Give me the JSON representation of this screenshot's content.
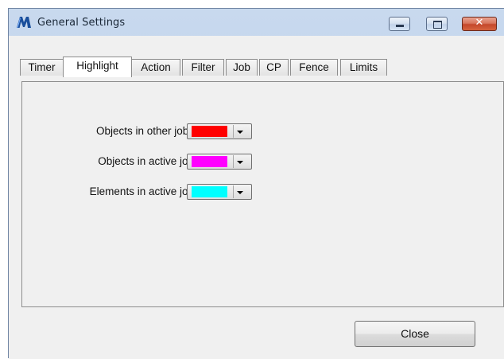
{
  "window": {
    "title": "General Settings",
    "app_icon": "microstation-m-icon",
    "caption_buttons": {
      "minimize": "minimize-icon",
      "maximize": "maximize-icon",
      "close": "close-icon",
      "close_glyph": "✕"
    }
  },
  "tabs": [
    {
      "label": "Timer",
      "active": false
    },
    {
      "label": "Highlight",
      "active": true
    },
    {
      "label": "Action",
      "active": false
    },
    {
      "label": "Filter",
      "active": false
    },
    {
      "label": "Job",
      "active": false
    },
    {
      "label": "CP",
      "active": false
    },
    {
      "label": "Fence",
      "active": false
    },
    {
      "label": "Limits",
      "active": false
    }
  ],
  "highlight": {
    "rows": [
      {
        "label": "Objects in other jobs",
        "color": "#ff0000"
      },
      {
        "label": "Objects in active job",
        "color": "#ff00ff"
      },
      {
        "label": "Elements in active job",
        "color": "#00ffff"
      }
    ]
  },
  "buttons": {
    "close_label": "Close"
  },
  "colors": {
    "app_icon": "#1a4f9c",
    "close_caption": "#c8482c"
  }
}
